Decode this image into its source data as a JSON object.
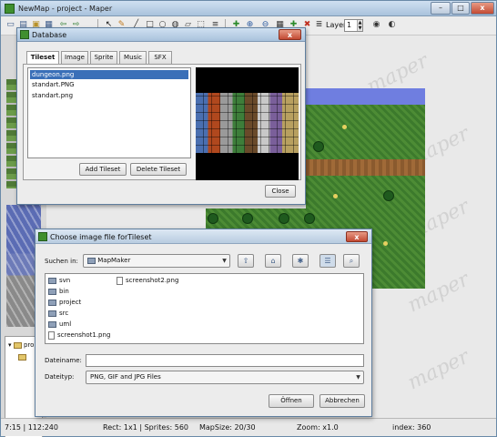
{
  "window": {
    "title": "NewMap - project - Maper",
    "controls": {
      "minimize": "–",
      "maximize": "□",
      "close": "x"
    }
  },
  "toolbar": {
    "layer_label": "Layer",
    "layer_value": "1",
    "icons": [
      "new-icon",
      "open-icon",
      "save-icon",
      "save-all-icon",
      "undo-icon",
      "redo-icon",
      "pointer-icon",
      "pencil-icon",
      "line-icon",
      "rectangle-icon",
      "ellipse-icon",
      "fill-icon",
      "eraser-icon",
      "select-icon",
      "properties-icon",
      "zoom-in-icon",
      "zoom-out-icon",
      "grid-icon",
      "layer-add-icon",
      "layer-remove-icon",
      "layer-visible-icon",
      "layer-lock-icon"
    ]
  },
  "tree": {
    "items": [
      "pro",
      ""
    ]
  },
  "watermark": "maper",
  "statusbar": {
    "cursor": "7:15 | 112:240",
    "rect": "Rect: 1x1 | Sprites: 560",
    "mapsize": "MapSize: 20/30",
    "zoom": "Zoom: x1.0",
    "index": "index: 360"
  },
  "database": {
    "title": "Database",
    "close": "x",
    "tabs": [
      "Tileset",
      "Image",
      "Sprite",
      "Music",
      "SFX"
    ],
    "active_tab": "Tileset",
    "tilesets": [
      "dungeon.png",
      "standart.PNG",
      "standart.png"
    ],
    "selected_index": 0,
    "add_button": "Add Tileset",
    "delete_button": "Delete Tileset",
    "close_button": "Close"
  },
  "file_chooser": {
    "title": "Choose image file forTileset",
    "close": "x",
    "look_in_label": "Suchen in:",
    "look_in_value": "MapMaker",
    "files_col1": [
      {
        "name": "svn",
        "kind": "folder"
      },
      {
        "name": "bin",
        "kind": "folder"
      },
      {
        "name": "project",
        "kind": "folder"
      },
      {
        "name": "src",
        "kind": "folder"
      },
      {
        "name": "uml",
        "kind": "folder"
      },
      {
        "name": "screenshot1.png",
        "kind": "file"
      }
    ],
    "files_col2": [
      {
        "name": "screenshot2.png",
        "kind": "file"
      }
    ],
    "filename_label": "Dateiname:",
    "filename_value": "",
    "filetype_label": "Dateityp:",
    "filetype_value": "PNG, GIF and JPG Files",
    "open_button": "Öffnen",
    "cancel_button": "Abbrechen"
  },
  "colors": {
    "title_bar": "#a9c2dc",
    "selection": "#3a6fb8",
    "close_button": "#c24a33",
    "water": "#6f7ee0",
    "grass": "#3c7a2c"
  }
}
